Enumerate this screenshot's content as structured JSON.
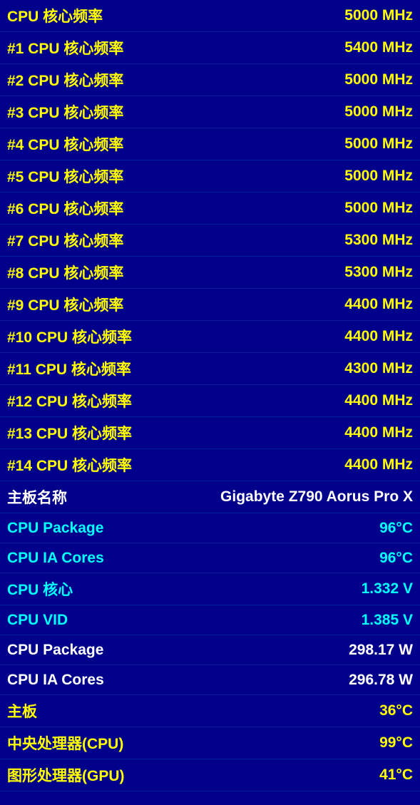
{
  "rows": [
    {
      "id": "cpu-core-freq",
      "label": "CPU 核心频率",
      "value": "5000 MHz",
      "type": "yellow"
    },
    {
      "id": "cpu-core-freq-1",
      "label": "#1 CPU 核心频率",
      "value": "5400 MHz",
      "type": "yellow"
    },
    {
      "id": "cpu-core-freq-2",
      "label": "#2 CPU 核心频率",
      "value": "5000 MHz",
      "type": "yellow"
    },
    {
      "id": "cpu-core-freq-3",
      "label": "#3 CPU 核心频率",
      "value": "5000 MHz",
      "type": "yellow"
    },
    {
      "id": "cpu-core-freq-4",
      "label": "#4 CPU 核心频率",
      "value": "5000 MHz",
      "type": "yellow"
    },
    {
      "id": "cpu-core-freq-5",
      "label": "#5 CPU 核心频率",
      "value": "5000 MHz",
      "type": "yellow"
    },
    {
      "id": "cpu-core-freq-6",
      "label": "#6 CPU 核心频率",
      "value": "5000 MHz",
      "type": "yellow"
    },
    {
      "id": "cpu-core-freq-7",
      "label": "#7 CPU 核心频率",
      "value": "5300 MHz",
      "type": "yellow"
    },
    {
      "id": "cpu-core-freq-8",
      "label": "#8 CPU 核心频率",
      "value": "5300 MHz",
      "type": "yellow"
    },
    {
      "id": "cpu-core-freq-9",
      "label": "#9 CPU 核心频率",
      "value": "4400 MHz",
      "type": "yellow"
    },
    {
      "id": "cpu-core-freq-10",
      "label": "#10 CPU 核心频率",
      "value": "4400 MHz",
      "type": "yellow"
    },
    {
      "id": "cpu-core-freq-11",
      "label": "#11 CPU 核心频率",
      "value": "4300 MHz",
      "type": "yellow"
    },
    {
      "id": "cpu-core-freq-12",
      "label": "#12 CPU 核心频率",
      "value": "4400 MHz",
      "type": "yellow"
    },
    {
      "id": "cpu-core-freq-13",
      "label": "#13 CPU 核心频率",
      "value": "4400 MHz",
      "type": "yellow"
    },
    {
      "id": "cpu-core-freq-14",
      "label": "#14 CPU 核心频率",
      "value": "4400 MHz",
      "type": "yellow"
    },
    {
      "id": "motherboard-name",
      "label": "主板名称",
      "value": "Gigabyte Z790 Aorus Pro X",
      "type": "white"
    },
    {
      "id": "cpu-package-temp",
      "label": "CPU Package",
      "value": "96°C",
      "type": "cyan"
    },
    {
      "id": "cpu-ia-cores-temp",
      "label": "CPU IA Cores",
      "value": "96°C",
      "type": "cyan"
    },
    {
      "id": "cpu-core-voltage",
      "label": "CPU 核心",
      "value": "1.332 V",
      "type": "cyan"
    },
    {
      "id": "cpu-vid",
      "label": "CPU VID",
      "value": "1.385 V",
      "type": "cyan"
    },
    {
      "id": "cpu-package-power",
      "label": "CPU Package",
      "value": "298.17 W",
      "type": "white"
    },
    {
      "id": "cpu-ia-cores-power",
      "label": "CPU IA Cores",
      "value": "296.78 W",
      "type": "white"
    },
    {
      "id": "motherboard-temp",
      "label": "主板",
      "value": "36°C",
      "type": "temp-yellow"
    },
    {
      "id": "cpu-temp",
      "label": "中央处理器(CPU)",
      "value": "99°C",
      "type": "temp-yellow"
    },
    {
      "id": "gpu-temp",
      "label": "图形处理器(GPU)",
      "value": "41°C",
      "type": "temp-yellow"
    }
  ]
}
